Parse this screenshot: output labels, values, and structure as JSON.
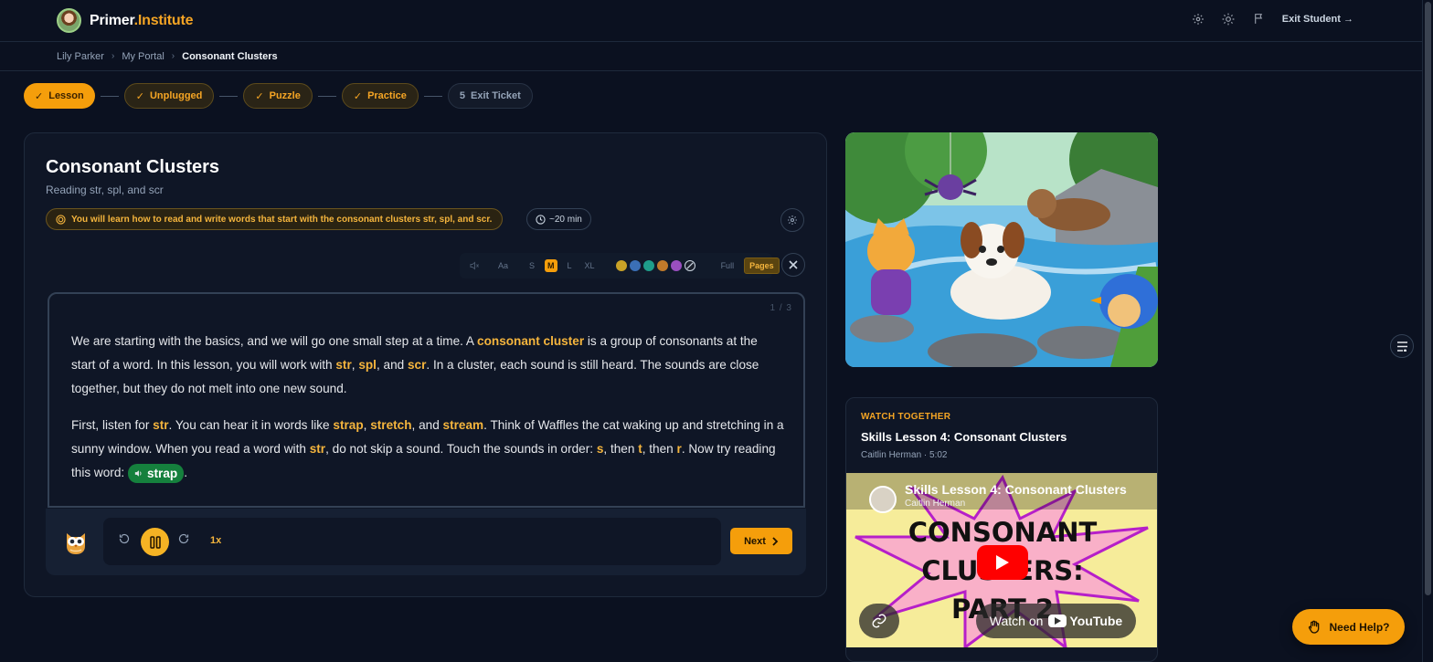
{
  "header": {
    "brand_part1": "Primer",
    "brand_part2": ".Institute",
    "exit_label": "Exit Student →"
  },
  "breadcrumb": [
    "Lily Parker",
    "My Portal",
    "Consonant Clusters"
  ],
  "stepper": [
    {
      "label": "Lesson",
      "state": "active",
      "prefix": "✓"
    },
    {
      "label": "Unplugged",
      "state": "done",
      "prefix": "✓"
    },
    {
      "label": "Puzzle",
      "state": "done",
      "prefix": "✓"
    },
    {
      "label": "Practice",
      "state": "done",
      "prefix": "✓"
    },
    {
      "label": "Exit Ticket",
      "state": "todo",
      "prefix": "5"
    }
  ],
  "lesson": {
    "title": "Consonant Clusters",
    "subtitle": "Reading str, spl, and scr",
    "goal": "You will learn how to read and write words that start with the consonant clusters str, spl, and scr.",
    "duration": "~20 min"
  },
  "toolbar": {
    "font_label": "Aa",
    "sizes": [
      "S",
      "M",
      "L",
      "XL"
    ],
    "active_size": "M",
    "colors": [
      "#c9a227",
      "#3b6fb6",
      "#1f9d8b",
      "#c07a2a",
      "#9a4fc0"
    ],
    "modes": [
      "Full",
      "Pages"
    ],
    "active_mode": "Pages"
  },
  "reader": {
    "pager": "1 / 3",
    "p1": {
      "t1": "We are starting with the basics, and we will go one small step at a time. A ",
      "h1": "consonant cluster",
      "t2": " is a group of consonants at the start of a word. In this lesson, you will work with ",
      "h2": "str",
      "t3": ", ",
      "h3": "spl",
      "t4": ", and ",
      "h4": "scr",
      "t5": ". In a cluster, each sound is still heard. The sounds are close together, but they do not melt into one new sound."
    },
    "p2": {
      "t1": "First, listen for ",
      "h1": "str",
      "t2": ". You can hear it in words like ",
      "h2": "strap",
      "t3": ", ",
      "h3": "stretch",
      "t4": ", and ",
      "h4": "stream",
      "t5": ". Think of Waffles the cat waking up and stretching in a sunny window. When you read a word with ",
      "h5": "str",
      "t6": ", do not skip a sound. Touch the sounds in order: ",
      "h6": "s",
      "t7": ", then ",
      "h7": "t",
      "t8": ", then ",
      "h8": "r",
      "t9": ". Now try reading this word: ",
      "chip": "strap",
      "t10": "."
    }
  },
  "player": {
    "speed": "1x",
    "next_label": "Next"
  },
  "video": {
    "label": "WATCH TOGETHER",
    "title": "Skills Lesson 4: Consonant Clusters",
    "meta": "Caitlin Herman · 5:02",
    "embed_title": "Skills Lesson 4: Consonant Clusters",
    "embed_channel": "Caitlin Herman",
    "thumb_line1": "CONSONANT",
    "thumb_line2": "CLUSTERS:",
    "thumb_line3": "PART 2",
    "watch_on": "Watch on",
    "youtube": "YouTube"
  },
  "help": {
    "label": "Need Help?"
  }
}
